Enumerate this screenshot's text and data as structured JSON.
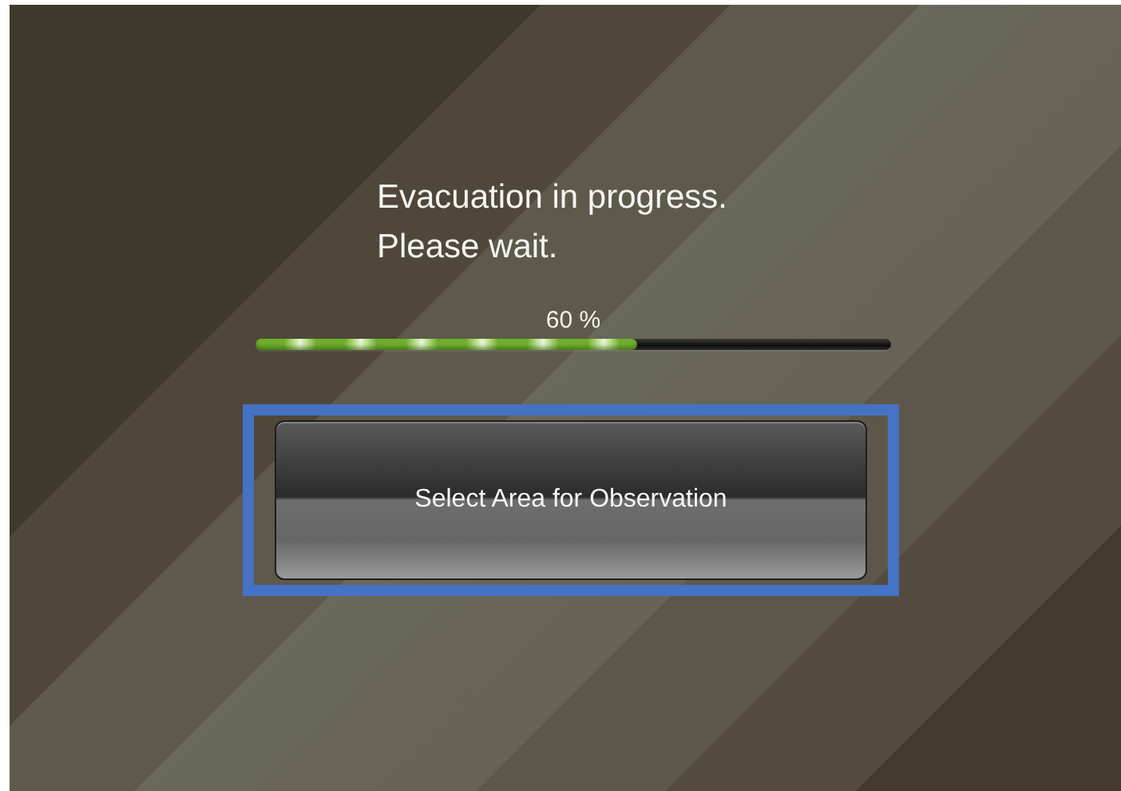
{
  "message": {
    "lines": [
      "Evacuation in progress.",
      "Please wait."
    ]
  },
  "progress": {
    "reading": "60 %",
    "level": 0.6
  },
  "button": {
    "label": "Select Area for Observation",
    "focused": true
  }
}
